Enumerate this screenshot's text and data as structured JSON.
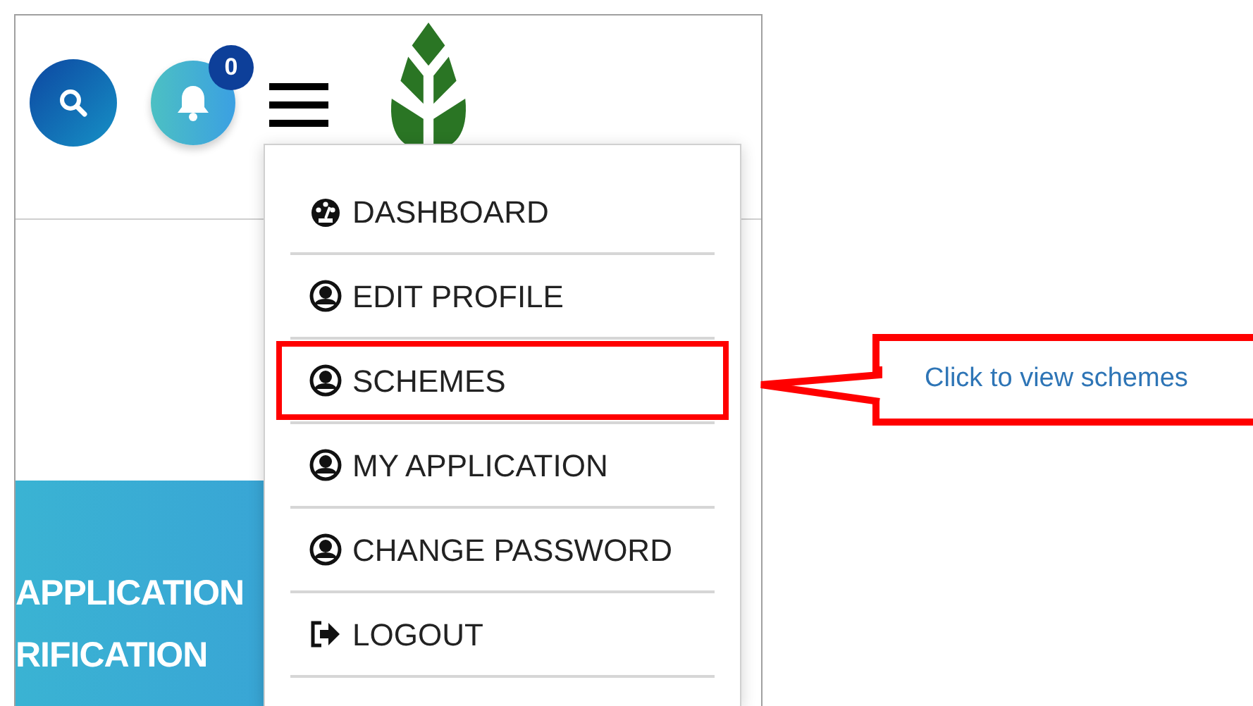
{
  "header": {
    "notification_count": "0"
  },
  "banner": {
    "lines": [
      "APPLICATION",
      "RIFICATION"
    ]
  },
  "menu": {
    "items": [
      {
        "label": "DASHBOARD",
        "kind": "dashboard",
        "highlighted": false
      },
      {
        "label": "EDIT PROFILE",
        "kind": "user",
        "highlighted": false
      },
      {
        "label": "SCHEMES",
        "kind": "user",
        "highlighted": true
      },
      {
        "label": "MY APPLICATION",
        "kind": "user",
        "highlighted": false
      },
      {
        "label": "CHANGE PASSWORD",
        "kind": "user",
        "highlighted": false
      },
      {
        "label": "LOGOUT",
        "kind": "logout",
        "highlighted": false
      }
    ]
  },
  "callout": {
    "text": "Click to view schemes"
  }
}
